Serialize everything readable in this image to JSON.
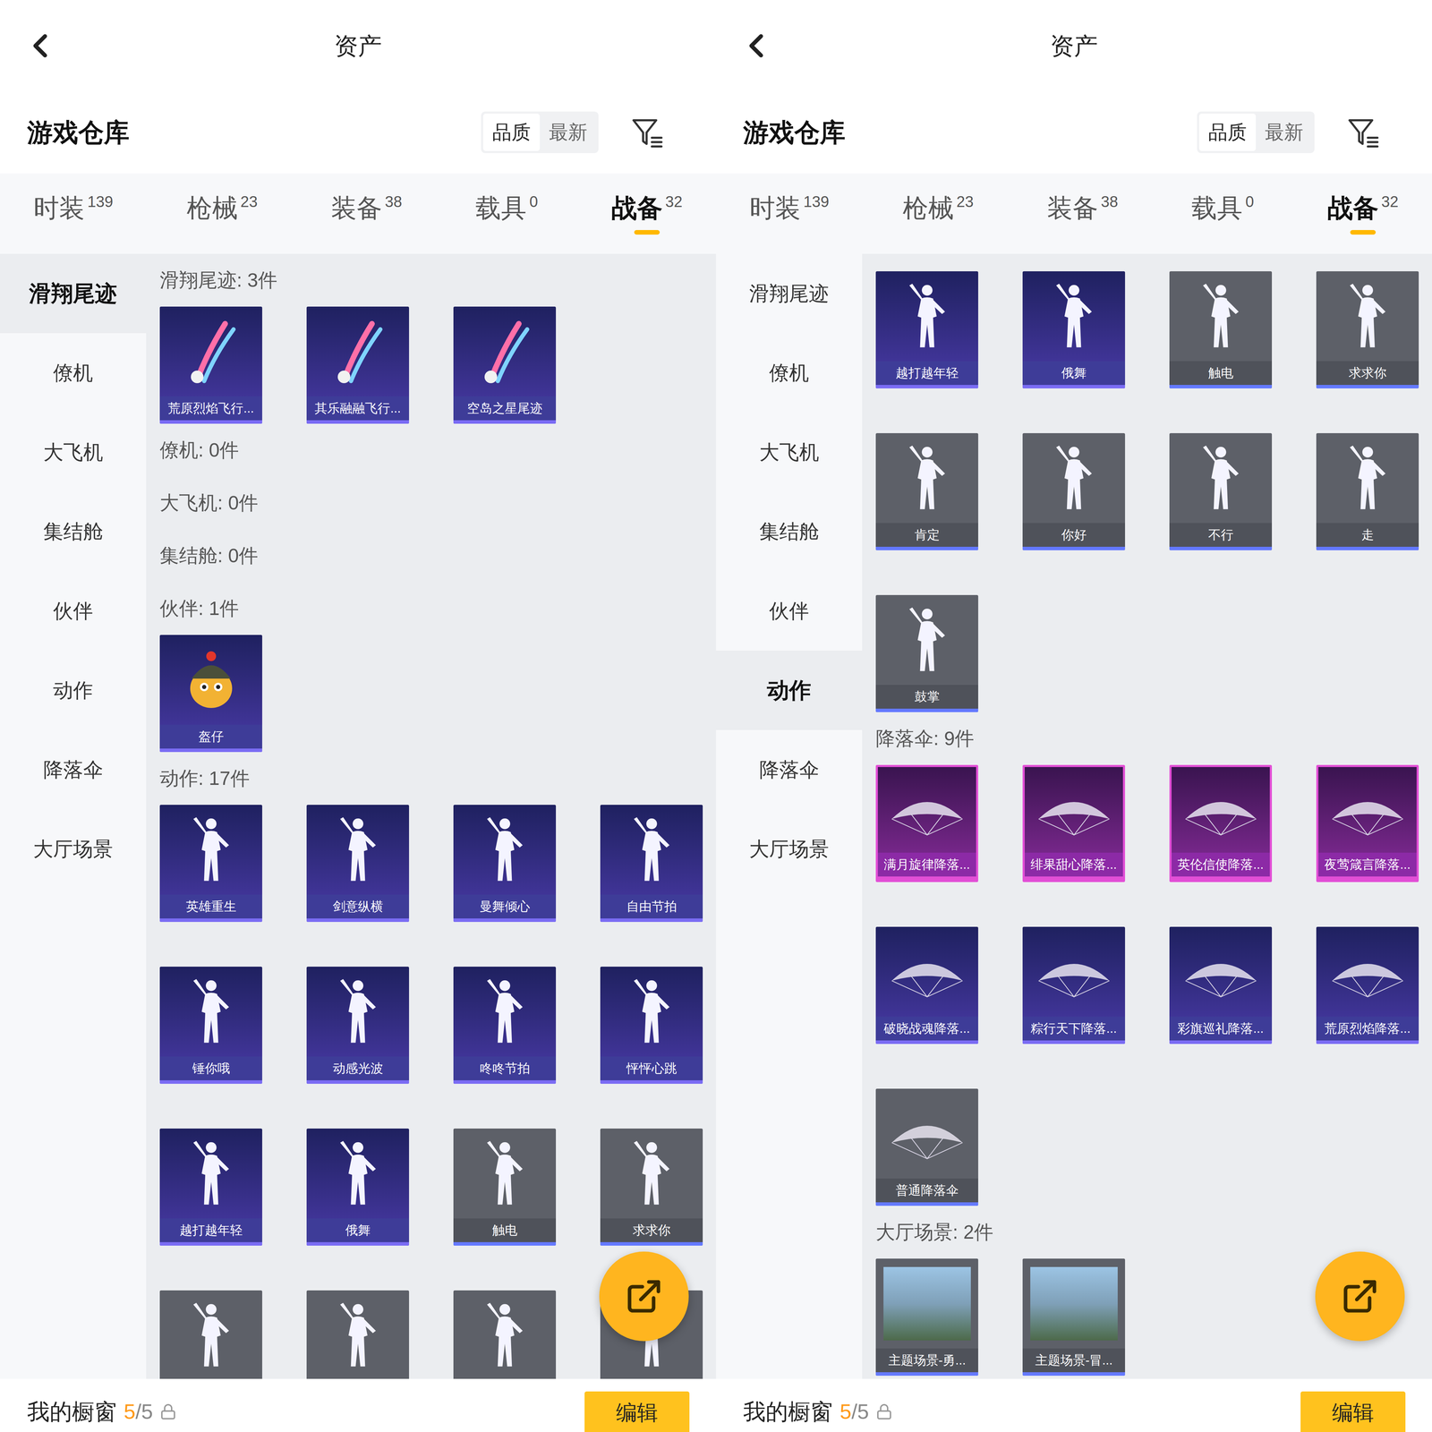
{
  "panels": [
    {
      "header": {
        "title": "资产"
      },
      "subheader": {
        "title": "游戏仓库",
        "sort": [
          {
            "label": "品质",
            "selected": true
          },
          {
            "label": "最新",
            "selected": false
          }
        ]
      },
      "tabs": [
        {
          "label": "时装",
          "count": "139",
          "selected": false
        },
        {
          "label": "枪械",
          "count": "23",
          "selected": false
        },
        {
          "label": "装备",
          "count": "38",
          "selected": false
        },
        {
          "label": "载具",
          "count": "0",
          "selected": false
        },
        {
          "label": "战备",
          "count": "32",
          "selected": true
        }
      ],
      "sidebar": [
        {
          "label": "滑翔尾迹",
          "selected": true
        },
        {
          "label": "僚机",
          "selected": false
        },
        {
          "label": "大飞机",
          "selected": false
        },
        {
          "label": "集结舱",
          "selected": false
        },
        {
          "label": "伙伴",
          "selected": false
        },
        {
          "label": "动作",
          "selected": false
        },
        {
          "label": "降落伞",
          "selected": false
        },
        {
          "label": "大厅场景",
          "selected": false
        }
      ],
      "sections": [
        {
          "header": "滑翔尾迹: 3件",
          "kind": "trail",
          "items": [
            {
              "name": "荒原烈焰飞行...",
              "quality": "rare"
            },
            {
              "name": "其乐融融飞行...",
              "quality": "rare"
            },
            {
              "name": "空岛之星尾迹",
              "quality": "rare"
            }
          ]
        },
        {
          "header": "僚机: 0件",
          "kind": "trail",
          "items": []
        },
        {
          "header": "大飞机: 0件",
          "kind": "trail",
          "items": []
        },
        {
          "header": "集结舱: 0件",
          "kind": "trail",
          "items": []
        },
        {
          "header": "伙伴: 1件",
          "kind": "partner",
          "items": [
            {
              "name": "盔仔",
              "quality": "rare"
            }
          ]
        },
        {
          "header": "动作: 17件",
          "kind": "emote",
          "items": [
            {
              "name": "英雄重生",
              "quality": "rare"
            },
            {
              "name": "剑意纵横",
              "quality": "rare"
            },
            {
              "name": "曼舞倾心",
              "quality": "rare"
            },
            {
              "name": "自由节拍",
              "quality": "rare"
            },
            {
              "name": "锤你哦",
              "quality": "rare"
            },
            {
              "name": "动感光波",
              "quality": "rare"
            },
            {
              "name": "咚咚节拍",
              "quality": "rare"
            },
            {
              "name": "怦怦心跳",
              "quality": "rare"
            },
            {
              "name": "越打越年轻",
              "quality": "rare"
            },
            {
              "name": "俄舞",
              "quality": "rare"
            },
            {
              "name": "触电",
              "quality": "common"
            },
            {
              "name": "求求你",
              "quality": "common"
            },
            {
              "name": "",
              "quality": "common"
            },
            {
              "name": "",
              "quality": "common"
            },
            {
              "name": "",
              "quality": "common"
            },
            {
              "name": "",
              "quality": "common"
            }
          ]
        }
      ],
      "showcase": {
        "title": "我的橱窗",
        "count": "5",
        "total": "/5",
        "button": "编辑"
      }
    },
    {
      "header": {
        "title": "资产"
      },
      "subheader": {
        "title": "游戏仓库",
        "sort": [
          {
            "label": "品质",
            "selected": true
          },
          {
            "label": "最新",
            "selected": false
          }
        ]
      },
      "tabs": [
        {
          "label": "时装",
          "count": "139",
          "selected": false
        },
        {
          "label": "枪械",
          "count": "23",
          "selected": false
        },
        {
          "label": "装备",
          "count": "38",
          "selected": false
        },
        {
          "label": "载具",
          "count": "0",
          "selected": false
        },
        {
          "label": "战备",
          "count": "32",
          "selected": true
        }
      ],
      "sidebar": [
        {
          "label": "滑翔尾迹",
          "selected": false
        },
        {
          "label": "僚机",
          "selected": false
        },
        {
          "label": "大飞机",
          "selected": false
        },
        {
          "label": "集结舱",
          "selected": false
        },
        {
          "label": "伙伴",
          "selected": false
        },
        {
          "label": "动作",
          "selected": true
        },
        {
          "label": "降落伞",
          "selected": false
        },
        {
          "label": "大厅场景",
          "selected": false
        }
      ],
      "sections": [
        {
          "header": "",
          "kind": "emote",
          "items": [
            {
              "name": "越打越年轻",
              "quality": "rare"
            },
            {
              "name": "俄舞",
              "quality": "rare"
            },
            {
              "name": "触电",
              "quality": "common"
            },
            {
              "name": "求求你",
              "quality": "common"
            },
            {
              "name": "肯定",
              "quality": "common"
            },
            {
              "name": "你好",
              "quality": "common"
            },
            {
              "name": "不行",
              "quality": "common"
            },
            {
              "name": "走",
              "quality": "common"
            },
            {
              "name": "鼓掌",
              "quality": "common"
            }
          ]
        },
        {
          "header": "降落伞: 9件",
          "kind": "parachute",
          "items": [
            {
              "name": "满月旋律降落...",
              "quality": "epic"
            },
            {
              "name": "绯果甜心降落...",
              "quality": "epic"
            },
            {
              "name": "英伦信使降落...",
              "quality": "epic"
            },
            {
              "name": "夜莺箴言降落...",
              "quality": "epic"
            },
            {
              "name": "破晓战魂降落...",
              "quality": "rare"
            },
            {
              "name": "粽行天下降落...",
              "quality": "rare"
            },
            {
              "name": "彩旗巡礼降落...",
              "quality": "rare"
            },
            {
              "name": "荒原烈焰降落...",
              "quality": "rare"
            },
            {
              "name": "普通降落伞",
              "quality": "common"
            }
          ]
        },
        {
          "header": "大厅场景: 2件",
          "kind": "scene",
          "items": [
            {
              "name": "主题场景-勇...",
              "quality": "common"
            },
            {
              "name": "主题场景-冒...",
              "quality": "common"
            }
          ]
        }
      ],
      "showcase": {
        "title": "我的橱窗",
        "count": "5",
        "total": "/5",
        "button": "编辑"
      }
    }
  ]
}
